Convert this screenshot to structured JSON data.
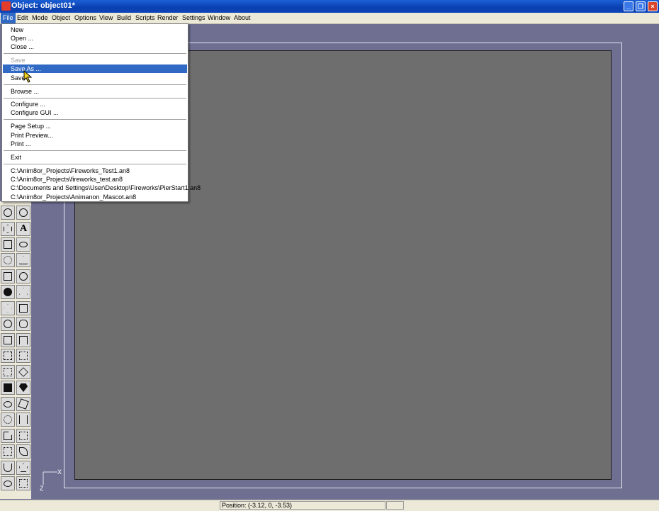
{
  "window": {
    "title": "Object: object01*"
  },
  "menubar": {
    "items": [
      "File",
      "Edit",
      "Mode",
      "Object",
      "Options",
      "View",
      "Build",
      "Scripts",
      "Render",
      "Settings",
      "Window",
      "About"
    ]
  },
  "file_menu": {
    "items": [
      "New",
      "Open ...",
      "Close ...",
      "Save",
      "Save As ...",
      "Save",
      "Browse ...",
      "Configure ...",
      "Configure GUI ...",
      "Page Setup ...",
      "Print Preview...",
      "Print ...",
      "Exit"
    ],
    "recent": [
      "C:\\Anim8or_Projects\\Fireworks_Test1.an8",
      "C:\\Anim8or_Projects\\fireworks_test.an8",
      "C:\\Documents and Settings\\User\\Desktop\\Fireworks\\PierStart1.an8",
      "C:\\Anim8or_Projects\\Animanon_Mascot.an8"
    ],
    "disabled_item": "Save",
    "selected_item": "Save As ..."
  },
  "axis": {
    "x_label": "X",
    "z_label": "Z"
  },
  "statusbar": {
    "position": "Position: (-3.12, 0, -3.53)"
  },
  "colors": {
    "titlebar": "#0a3fb0",
    "workspace": "#6f6f92",
    "viewport": "#6e6e6e",
    "highlight": "#316ac5"
  }
}
